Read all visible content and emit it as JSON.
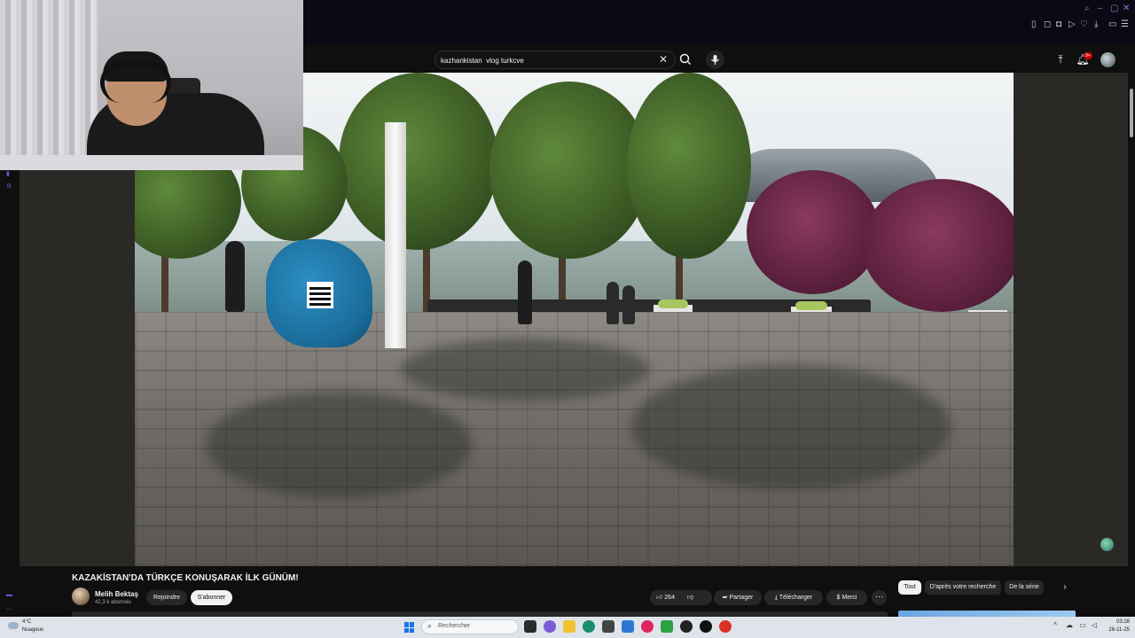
{
  "search": {
    "query": "kazhankistan  vlog turkcve"
  },
  "header": {
    "notification_count": "9+"
  },
  "video": {
    "title": "KAZAKİSTAN'DA TÜRKÇE KONUŞARAK İLK GÜNÜM!",
    "channel_name": "Melih Bektaş",
    "subscribers": "42,3 k abonnés",
    "join_label": "Rejoindre",
    "subscribe_label": "S'abonner",
    "like_count": "264",
    "share_label": "Partager",
    "download_label": "Télécharger",
    "thanks_label": "Merci",
    "more_label": "⋯"
  },
  "chips": {
    "all": "Tout",
    "from_search": "D'après votre recherche",
    "from_series": "De la série"
  },
  "taskbar": {
    "weather_temp": "4°C",
    "weather_desc": "Nuageux",
    "search_placeholder": "Rechercher",
    "time": "03:28",
    "date": "26-11-25"
  },
  "icons": {
    "search": "search-icon",
    "mic": "microphone-icon",
    "upload": "upload-icon",
    "bell": "bell-icon",
    "like": "thumbs-up-icon",
    "dislike": "thumbs-down-icon",
    "share": "share-icon",
    "download": "download-icon",
    "thanks": "super-thanks-icon"
  },
  "colors": {
    "background": "#0f0f0f",
    "accent_red": "#cc0000",
    "chip_active": "#f1f1f1"
  }
}
